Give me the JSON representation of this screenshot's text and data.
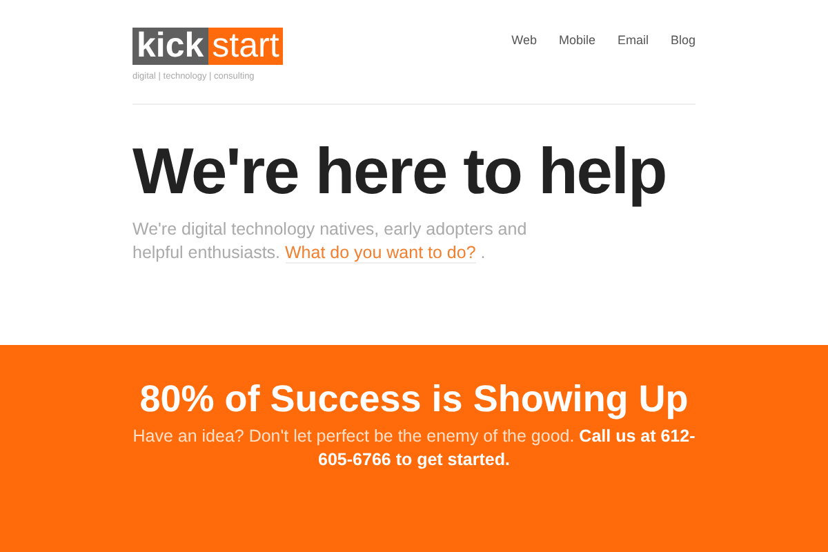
{
  "logo": {
    "left": "kick",
    "right": "start"
  },
  "tagline": "digital | technology | consulting",
  "nav": [
    {
      "label": "Web"
    },
    {
      "label": "Mobile"
    },
    {
      "label": "Email"
    },
    {
      "label": "Blog"
    }
  ],
  "hero": {
    "title": "We're here to help",
    "text": "We're digital technology natives, early adopters and helpful enthusiasts.",
    "link": "What do you want to do?",
    "text_after": "."
  },
  "banner": {
    "title": "80% of Success is Showing Up",
    "text": "Have an idea? Don't let perfect be the enemy of the good. **Call us at 612-605-6766 to get started.**"
  }
}
